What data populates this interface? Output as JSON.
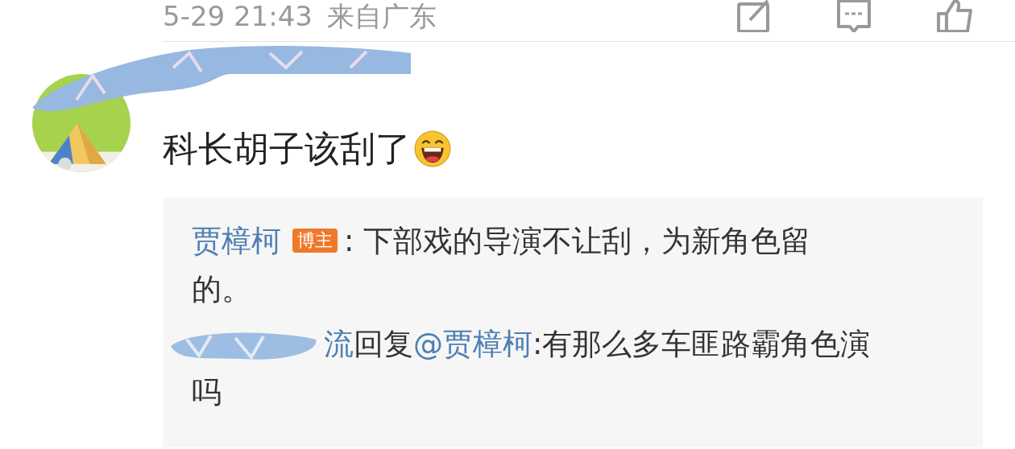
{
  "post_meta": {
    "time": "5-29 21:43",
    "location": "来自广东"
  },
  "comment": {
    "text": "科长胡子该刮了",
    "emoji": true
  },
  "replies": [
    {
      "author": "贾樟柯",
      "badge": "博主",
      "text": ": 下部戏的导演不让刮，为新角色留",
      "text_continued": "的。"
    },
    {
      "author": "流",
      "verb": "回复",
      "mention": "@贾樟柯",
      "text": ":有那么多车匪路霸角色演",
      "text_continued": "吗"
    }
  ]
}
